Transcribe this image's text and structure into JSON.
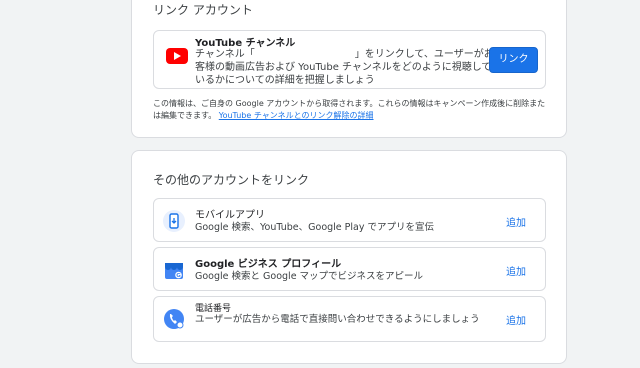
{
  "link_account": {
    "title": "リンク アカウント",
    "youtube": {
      "title": "YouTube チャンネル",
      "description": "チャンネル「　　　　　　　　　　」をリンクして、ユーザーがお客様の動画広告および YouTube チャンネルをどのように視聴しているかについての詳細を把握しましょう",
      "button_label": "リンク"
    },
    "note_text": "この情報は、ご自身の Google アカウントから取得されます。これらの情報はキャンペーン作成後に削除または編集できます。",
    "note_link": "YouTube チャンネルとのリンク解除の詳細"
  },
  "other_accounts": {
    "title": "その他のアカウントをリンク",
    "rows": [
      {
        "title": "モバイルアプリ",
        "description": "Google 検索、YouTube、Google Play でアプリを宣伝",
        "action": "追加",
        "icon": "mobile-app-icon"
      },
      {
        "title": "Google ビジネス プロフィール",
        "description": "Google 検索と Google マップでビジネスをアピール",
        "action": "追加",
        "icon": "business-profile-icon"
      },
      {
        "title": "電話番号",
        "description": "ユーザーが広告から電話で直接問い合わせできるようにしましょう",
        "action": "追加",
        "icon": "phone-icon"
      }
    ]
  },
  "colors": {
    "accent": "#1a73e8",
    "youtube_red": "#ff0000",
    "background": "#f1f3f4"
  }
}
